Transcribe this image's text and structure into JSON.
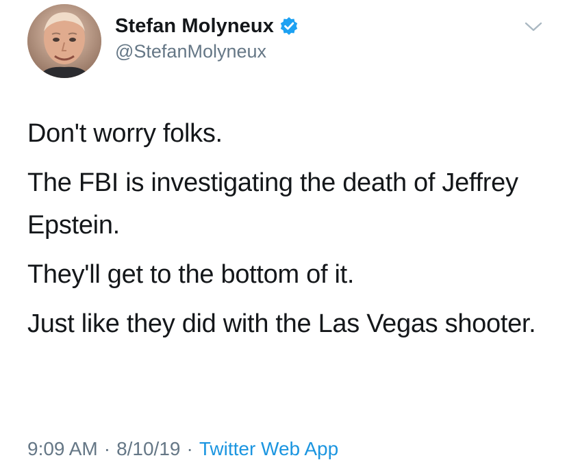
{
  "author": {
    "name": "Stefan Molyneux",
    "handle": "@StefanMolyneux",
    "verified": true
  },
  "tweet": {
    "paragraphs": [
      "Don't worry folks.",
      "The FBI is investigating the death of Jeffrey Epstein.",
      "They'll get to the bottom of it.",
      "Just like they did with the Las Vegas shooter."
    ]
  },
  "meta": {
    "time": "9:09 AM",
    "separator": "·",
    "date": "8/10/19",
    "source": "Twitter Web App"
  },
  "icons": {
    "verified": "verified-badge-icon",
    "menu": "chevron-down-icon"
  },
  "colors": {
    "text": "#14171a",
    "secondary": "#657786",
    "link": "#1b95e0",
    "verified": "#1da1f2"
  }
}
